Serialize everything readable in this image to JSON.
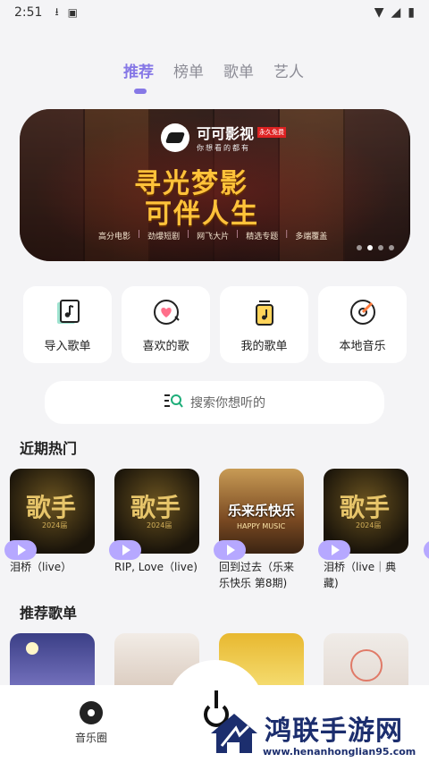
{
  "status_bar": {
    "time": "2:51"
  },
  "tabs": [
    {
      "label": "推荐",
      "active": true
    },
    {
      "label": "榜单",
      "active": false
    },
    {
      "label": "歌单",
      "active": false
    },
    {
      "label": "艺人",
      "active": false
    }
  ],
  "banner": {
    "brand": "可可影视",
    "slogan": "你想看的都有",
    "tag": "永久免费",
    "headline_1": "寻光梦影",
    "headline_2": "可伴人生",
    "features": [
      "高分电影",
      "劲爆短剧",
      "网飞大片",
      "精选专题",
      "多端覆盖"
    ],
    "page_count": 4,
    "current_page": 2
  },
  "quick_actions": [
    {
      "label": "导入歌单",
      "icon": "import-playlist-icon"
    },
    {
      "label": "喜欢的歌",
      "icon": "heart-music-icon"
    },
    {
      "label": "我的歌单",
      "icon": "my-playlist-icon"
    },
    {
      "label": "本地音乐",
      "icon": "local-music-disc-icon"
    }
  ],
  "search": {
    "placeholder": "搜索你想听的"
  },
  "recent_hot": {
    "title": "近期热门",
    "items": [
      {
        "title": "泪桥（live）",
        "cover_text": "歌手",
        "cover_year": "2024届"
      },
      {
        "title": "RIP, Love（live)",
        "cover_text": "歌手",
        "cover_year": "2024届"
      },
      {
        "title": "回到过去（乐来乐快乐 第8期)",
        "cover_text": "乐来乐快乐",
        "cover_year": "HAPPY MUSIC"
      },
      {
        "title": "泪桥（live｜典藏)",
        "cover_text": "歌手",
        "cover_year": "2024届"
      }
    ]
  },
  "recommended": {
    "title": "推荐歌单"
  },
  "bottom_nav": {
    "left_label": "音乐圈"
  },
  "watermark": {
    "name": "鸿联手游网",
    "url": "www.henanhonglian95.com"
  },
  "colors": {
    "accent": "#8678e6",
    "play_badge": "#b6a8ff",
    "watermark": "#1c2e6e"
  }
}
